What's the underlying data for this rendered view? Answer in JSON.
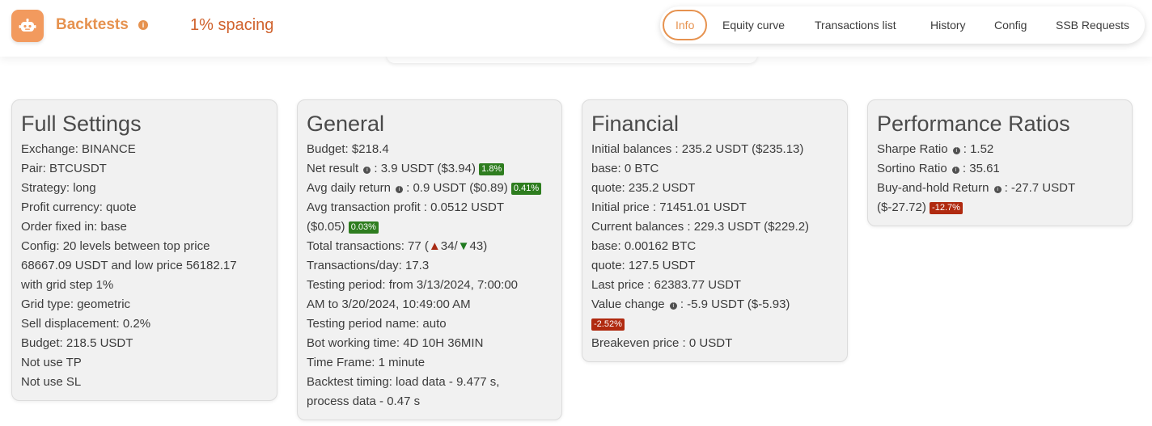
{
  "header": {
    "app_title": "Backtests",
    "subtitle": "1% spacing",
    "nav": [
      {
        "label": "Info",
        "active": true
      },
      {
        "label": "Equity curve"
      },
      {
        "label": "Transactions list"
      },
      {
        "label": "History"
      },
      {
        "label": "Config"
      },
      {
        "label": "SSB Requests"
      }
    ]
  },
  "full_settings": {
    "title": "Full Settings",
    "lines": [
      "Exchange: BINANCE",
      "Pair: BTCUSDT",
      "Strategy: long",
      "Profit currency: quote",
      "Order fixed in: base",
      "Config: 20 levels between top price",
      "68667.09 USDT and low price 56182.17",
      "with grid step 1%",
      "Grid type: geometric",
      "Sell displacement: 0.2%",
      "Budget: 218.5 USDT",
      "Not use TP",
      "Not use SL"
    ]
  },
  "general": {
    "title": "General",
    "budget": "Budget: $218.4",
    "net_result_label": "Net result",
    "net_result_value": ": 3.9 USDT ($3.94)",
    "net_result_badge": "1.8%",
    "avg_daily_label": "Avg daily return",
    "avg_daily_value": ": 0.9 USDT ($0.89)",
    "avg_daily_badge": "0.41%",
    "avg_tx_line1": "Avg transaction profit : 0.0512 USDT",
    "avg_tx_line2": "($0.05)",
    "avg_tx_badge": "0.03%",
    "total_tx_prefix": "Total transactions: 77 (",
    "total_tx_up_icon": "▲",
    "total_tx_up": "34",
    "total_tx_sep": "/",
    "total_tx_down_icon": "▼",
    "total_tx_down": "43",
    "total_tx_suffix": ")",
    "tx_per_day": "Transactions/day: 17.3",
    "testing_period_1": "Testing period: from 3/13/2024, 7:00:00",
    "testing_period_2": "AM to 3/20/2024, 10:49:00 AM",
    "testing_period_name": "Testing period name: auto",
    "bot_working_time": "Bot working time: 4D 10H 36MIN",
    "time_frame": "Time Frame: 1 minute",
    "backtest_timing_1": "Backtest timing: load data - 9.477 s,",
    "backtest_timing_2": "process data - 0.47 s"
  },
  "financial": {
    "title": "Financial",
    "lines_before": [
      "Initial balances : 235.2 USDT ($235.13)",
      "base: 0 BTC",
      "quote: 235.2 USDT",
      "Initial price : 71451.01 USDT",
      "Current balances : 229.3 USDT ($229.2)",
      "base: 0.00162 BTC",
      "quote: 127.5 USDT",
      "Last price : 62383.77 USDT"
    ],
    "value_change_label": "Value change",
    "value_change_value": ": -5.9 USDT ($-5.93)",
    "value_change_badge": "-2.52%",
    "breakeven": "Breakeven price : 0 USDT"
  },
  "performance": {
    "title": "Performance Ratios",
    "sharpe_label": "Sharpe Ratio",
    "sharpe_value": ": 1.52",
    "sortino_label": "Sortino Ratio",
    "sortino_value": ": 35.61",
    "buyhold_label": "Buy-and-hold Return",
    "buyhold_value": ": -27.7 USDT",
    "buyhold_line2": "($-27.72)",
    "buyhold_badge": "-12.7%"
  },
  "colors": {
    "accent": "#e6924f",
    "subtitle": "#d0622d",
    "positive_badge": "#2e7d1f",
    "negative_badge": "#b02a10"
  },
  "icons": {
    "logo": "robot-icon",
    "title_info": "info-icon",
    "metric_info": "info-dot-icon"
  }
}
